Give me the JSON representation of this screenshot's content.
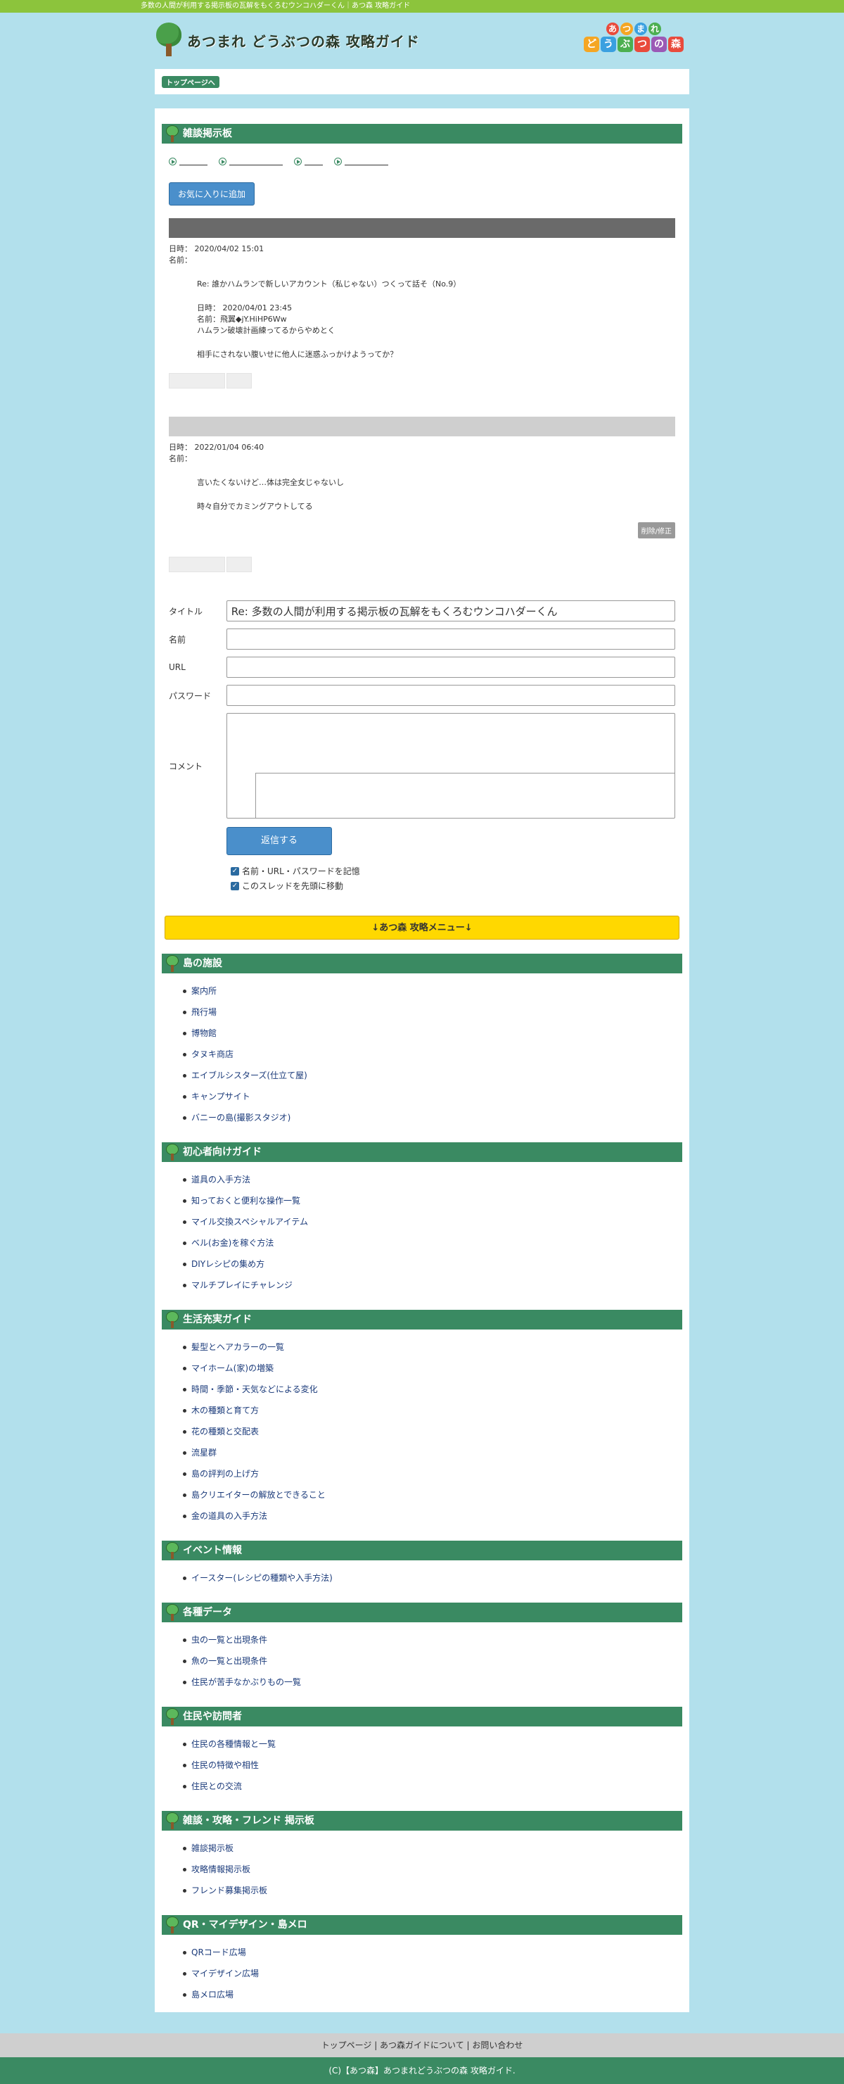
{
  "topbar": {
    "text": "多数の人間が利用する掲示板の瓦解をもくろむウンコハダーくん｜あつ森 攻略ガイド"
  },
  "header": {
    "title": "あつまれ どうぶつの森 攻略ガイド",
    "logo_row1": [
      "あ",
      "つ",
      "ま",
      "れ"
    ],
    "logo_row2": [
      "ど",
      "う",
      "ぶ",
      "つ",
      "の",
      "森"
    ],
    "logo_colors": [
      "#e94b3c",
      "#f5a623",
      "#3aa0e0",
      "#4caf50",
      "#e94b3c",
      "#9b59b6"
    ]
  },
  "breadcrumb": {
    "top_label": "トップページへ"
  },
  "board": {
    "heading": "雑談掲示板",
    "fav_label": "お気に入りに追加",
    "posts": [
      {
        "date_label": "日時：",
        "date": "2020/04/02 15:01",
        "name_label": "名前：",
        "name": "",
        "quote_title": "Re: 誰かハムランで新しいアカウント（私じゃない）つくって話そ（No.9）",
        "quote_date": "日時： 2020/04/01 23:45",
        "quote_name": "名前：飛翼◆jY.HiHP6Ww",
        "quote_text": "ハムラン破壊計画練ってるからやめとく",
        "reply": "相手にされない腹いせに他人に迷惑ふっかけようってか？"
      },
      {
        "date_label": "日時：",
        "date": "2022/01/04 06:40",
        "name_label": "名前：",
        "name": "",
        "line1": "言いたくないけど…体は完全女じゃないし",
        "line2": "時々自分でカミングアウトしてる",
        "del_label": "削除/修正"
      }
    ]
  },
  "form": {
    "title_label": "タイトル",
    "title_value": "Re: 多数の人間が利用する掲示板の瓦解をもくろむウンコハダーくん",
    "name_label": "名前",
    "url_label": "URL",
    "password_label": "パスワード",
    "comment_label": "コメント",
    "submit_label": "返信する",
    "remember_label": "名前・URL・パスワードを記憶",
    "move_label": "このスレッドを先頭に移動"
  },
  "menu": {
    "banner": "↓あつ森 攻略メニュー↓",
    "sections": [
      {
        "title": "島の施設",
        "items": [
          "案内所",
          "飛行場",
          "博物館",
          "タヌキ商店",
          "エイブルシスターズ(仕立て屋)",
          "キャンプサイト",
          "バニーの島(撮影スタジオ)"
        ]
      },
      {
        "title": "初心者向けガイド",
        "items": [
          "道具の入手方法",
          "知っておくと便利な操作一覧",
          "マイル交換スペシャルアイテム",
          "ベル(お金)を稼ぐ方法",
          "DIYレシピの集め方",
          "マルチプレイにチャレンジ"
        ]
      },
      {
        "title": "生活充実ガイド",
        "items": [
          "髪型とヘアカラーの一覧",
          "マイホーム(家)の増築",
          "時間・季節・天気などによる変化",
          "木の種類と育て方",
          "花の種類と交配表",
          "流星群",
          "島の評判の上げ方",
          "島クリエイターの解放とできること",
          "金の道具の入手方法"
        ]
      },
      {
        "title": "イベント情報",
        "items": [
          "イースター(レシピの種類や入手方法)"
        ]
      },
      {
        "title": "各種データ",
        "items": [
          "虫の一覧と出現条件",
          "魚の一覧と出現条件",
          "住民が苦手なかぶりもの一覧"
        ]
      },
      {
        "title": "住民や訪問者",
        "items": [
          "住民の各種情報と一覧",
          "住民の特徴や相性",
          "住民との交流"
        ]
      },
      {
        "title": "雑談・攻略・フレンド 掲示板",
        "items": [
          "雑談掲示板",
          "攻略情報掲示板",
          "フレンド募集掲示板"
        ]
      },
      {
        "title": "QR・マイデザイン・島メロ",
        "items": [
          "QRコード広場",
          "マイデザイン広場",
          "島メロ広場"
        ]
      }
    ]
  },
  "footer": {
    "links": "トップページ | あつ森ガイドについて | お問い合わせ",
    "copyright": "(C)【あつ森】あつまれどうぶつの森 攻略ガイド."
  }
}
